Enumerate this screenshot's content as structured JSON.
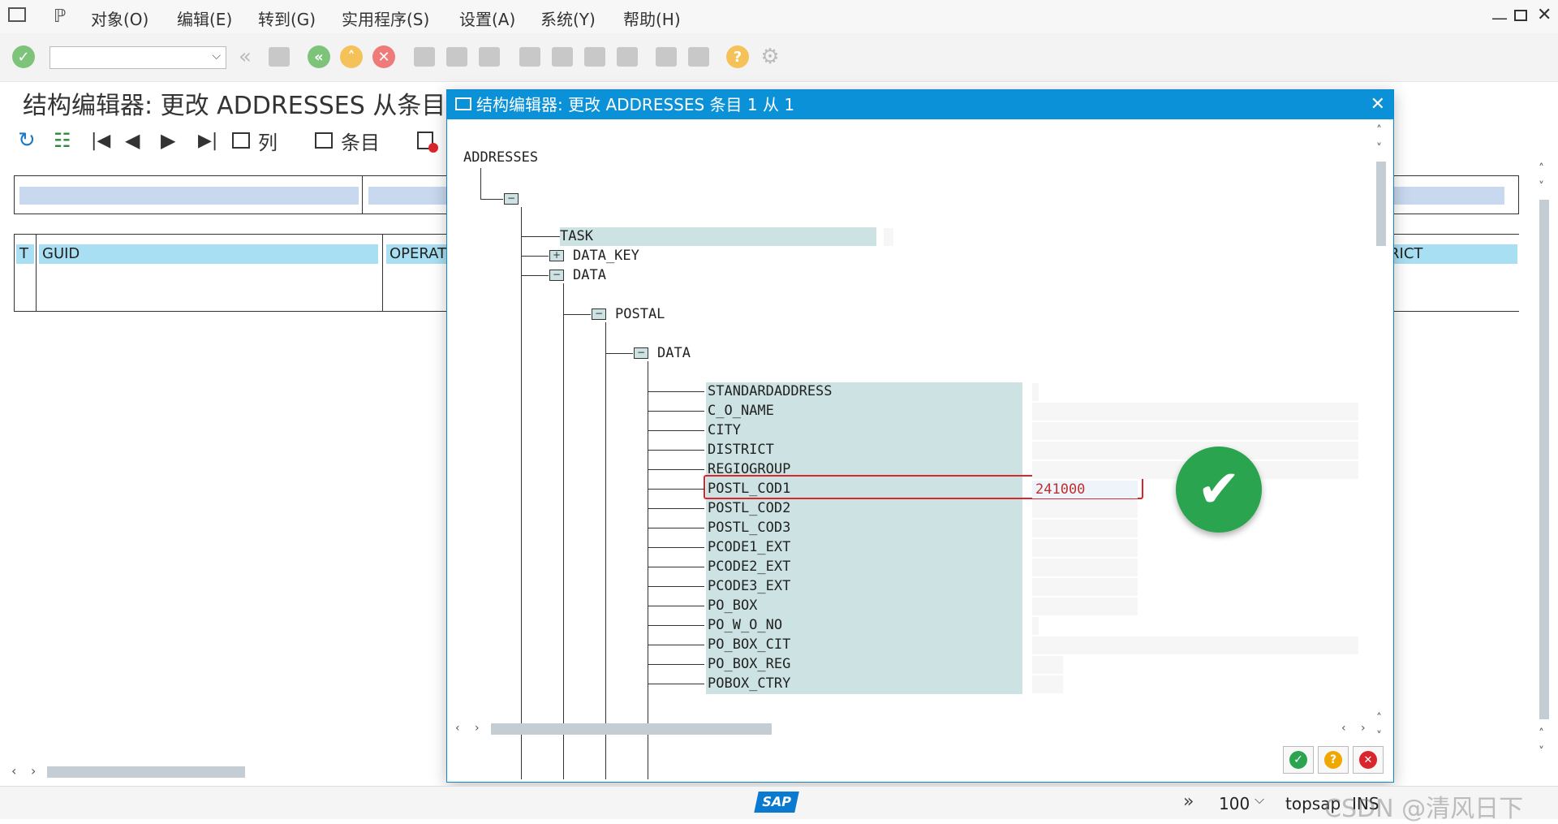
{
  "menu": {
    "items": [
      "对象(O)",
      "编辑(E)",
      "转到(G)",
      "实用程序(S)",
      "设置(A)",
      "系统(Y)",
      "帮助(H)"
    ]
  },
  "app": {
    "title": "结构编辑器: 更改 ADDRESSES 从条目",
    "btn_columns": "列",
    "btn_entries": "条目"
  },
  "bg_table": {
    "col1": "T",
    "col2": "GUID",
    "col3": "OPERAT",
    "col4": "RICT"
  },
  "dialog": {
    "title": "结构编辑器: 更改 ADDRESSES 条目 1 从 1",
    "root": "ADDRESSES",
    "nodes": {
      "task": "TASK",
      "data_key": "DATA_KEY",
      "data": "DATA",
      "postal": "POSTAL",
      "postal_data": "DATA"
    },
    "fields": [
      {
        "name": "STANDARDADDRESS",
        "value": ""
      },
      {
        "name": "C_O_NAME",
        "value": ""
      },
      {
        "name": "CITY",
        "value": ""
      },
      {
        "name": "DISTRICT",
        "value": ""
      },
      {
        "name": "REGIOGROUP",
        "value": ""
      },
      {
        "name": "POSTL_COD1",
        "value": "241000"
      },
      {
        "name": "POSTL_COD2",
        "value": ""
      },
      {
        "name": "POSTL_COD3",
        "value": ""
      },
      {
        "name": "PCODE1_EXT",
        "value": ""
      },
      {
        "name": "PCODE2_EXT",
        "value": ""
      },
      {
        "name": "PCODE3_EXT",
        "value": ""
      },
      {
        "name": "PO_BOX",
        "value": ""
      },
      {
        "name": "PO_W_O_NO",
        "value": ""
      },
      {
        "name": "PO_BOX_CIT",
        "value": ""
      },
      {
        "name": "PO_BOX_REG",
        "value": ""
      },
      {
        "name": "POBOX_CTRY",
        "value": ""
      }
    ]
  },
  "status": {
    "zoom": "100",
    "system": "topsap",
    "mode": "INS",
    "watermark": "CSDN @清风日下",
    "logo": "SAP"
  },
  "colors": {
    "accent": "#0a91d8",
    "highlight_red": "#d9262c",
    "ok_green": "#2aa44f"
  }
}
